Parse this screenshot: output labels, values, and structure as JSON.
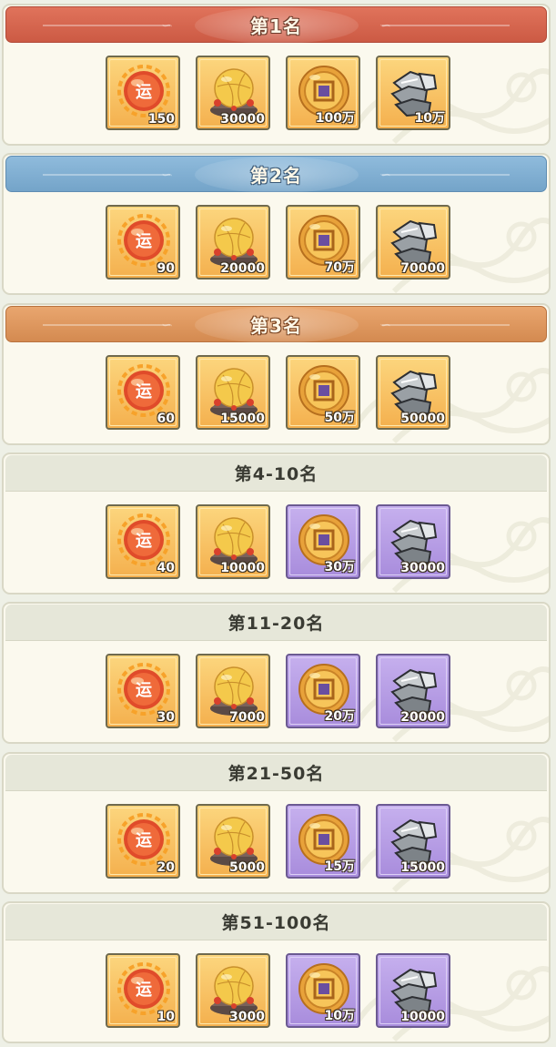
{
  "tiers": [
    {
      "title": "第1名",
      "style": "gold",
      "rewards": [
        {
          "icon": "luck-orb-icon",
          "qty": "150",
          "frame": "orange"
        },
        {
          "icon": "golden-egg-icon",
          "qty": "30000",
          "frame": "orange"
        },
        {
          "icon": "gold-coin-icon",
          "qty": "100万",
          "frame": "orange"
        },
        {
          "icon": "iron-ore-icon",
          "qty": "10万",
          "frame": "orange"
        }
      ]
    },
    {
      "title": "第2名",
      "style": "silver",
      "rewards": [
        {
          "icon": "luck-orb-icon",
          "qty": "90",
          "frame": "orange"
        },
        {
          "icon": "golden-egg-icon",
          "qty": "20000",
          "frame": "orange"
        },
        {
          "icon": "gold-coin-icon",
          "qty": "70万",
          "frame": "orange"
        },
        {
          "icon": "iron-ore-icon",
          "qty": "70000",
          "frame": "orange"
        }
      ]
    },
    {
      "title": "第3名",
      "style": "bronze",
      "rewards": [
        {
          "icon": "luck-orb-icon",
          "qty": "60",
          "frame": "orange"
        },
        {
          "icon": "golden-egg-icon",
          "qty": "15000",
          "frame": "orange"
        },
        {
          "icon": "gold-coin-icon",
          "qty": "50万",
          "frame": "orange"
        },
        {
          "icon": "iron-ore-icon",
          "qty": "50000",
          "frame": "orange"
        }
      ]
    },
    {
      "title": "第4-10名",
      "style": "plain",
      "rewards": [
        {
          "icon": "luck-orb-icon",
          "qty": "40",
          "frame": "orange"
        },
        {
          "icon": "golden-egg-icon",
          "qty": "10000",
          "frame": "orange"
        },
        {
          "icon": "gold-coin-icon",
          "qty": "30万",
          "frame": "purple"
        },
        {
          "icon": "iron-ore-icon",
          "qty": "30000",
          "frame": "purple"
        }
      ]
    },
    {
      "title": "第11-20名",
      "style": "plain",
      "rewards": [
        {
          "icon": "luck-orb-icon",
          "qty": "30",
          "frame": "orange"
        },
        {
          "icon": "golden-egg-icon",
          "qty": "7000",
          "frame": "orange"
        },
        {
          "icon": "gold-coin-icon",
          "qty": "20万",
          "frame": "purple"
        },
        {
          "icon": "iron-ore-icon",
          "qty": "20000",
          "frame": "purple"
        }
      ]
    },
    {
      "title": "第21-50名",
      "style": "plain",
      "rewards": [
        {
          "icon": "luck-orb-icon",
          "qty": "20",
          "frame": "orange"
        },
        {
          "icon": "golden-egg-icon",
          "qty": "5000",
          "frame": "orange"
        },
        {
          "icon": "gold-coin-icon",
          "qty": "15万",
          "frame": "purple"
        },
        {
          "icon": "iron-ore-icon",
          "qty": "15000",
          "frame": "purple"
        }
      ]
    },
    {
      "title": "第51-100名",
      "style": "plain",
      "rewards": [
        {
          "icon": "luck-orb-icon",
          "qty": "10",
          "frame": "orange"
        },
        {
          "icon": "golden-egg-icon",
          "qty": "3000",
          "frame": "orange"
        },
        {
          "icon": "gold-coin-icon",
          "qty": "10万",
          "frame": "purple"
        },
        {
          "icon": "iron-ore-icon",
          "qty": "10000",
          "frame": "purple"
        }
      ]
    }
  ],
  "luck_orb_glyph": "运",
  "colors": {
    "gold_header": "#d4644d",
    "silver_header": "#82aed3",
    "bronze_header": "#de9860",
    "orange_frame": "#f8c46a",
    "purple_frame": "#b59ee4"
  }
}
